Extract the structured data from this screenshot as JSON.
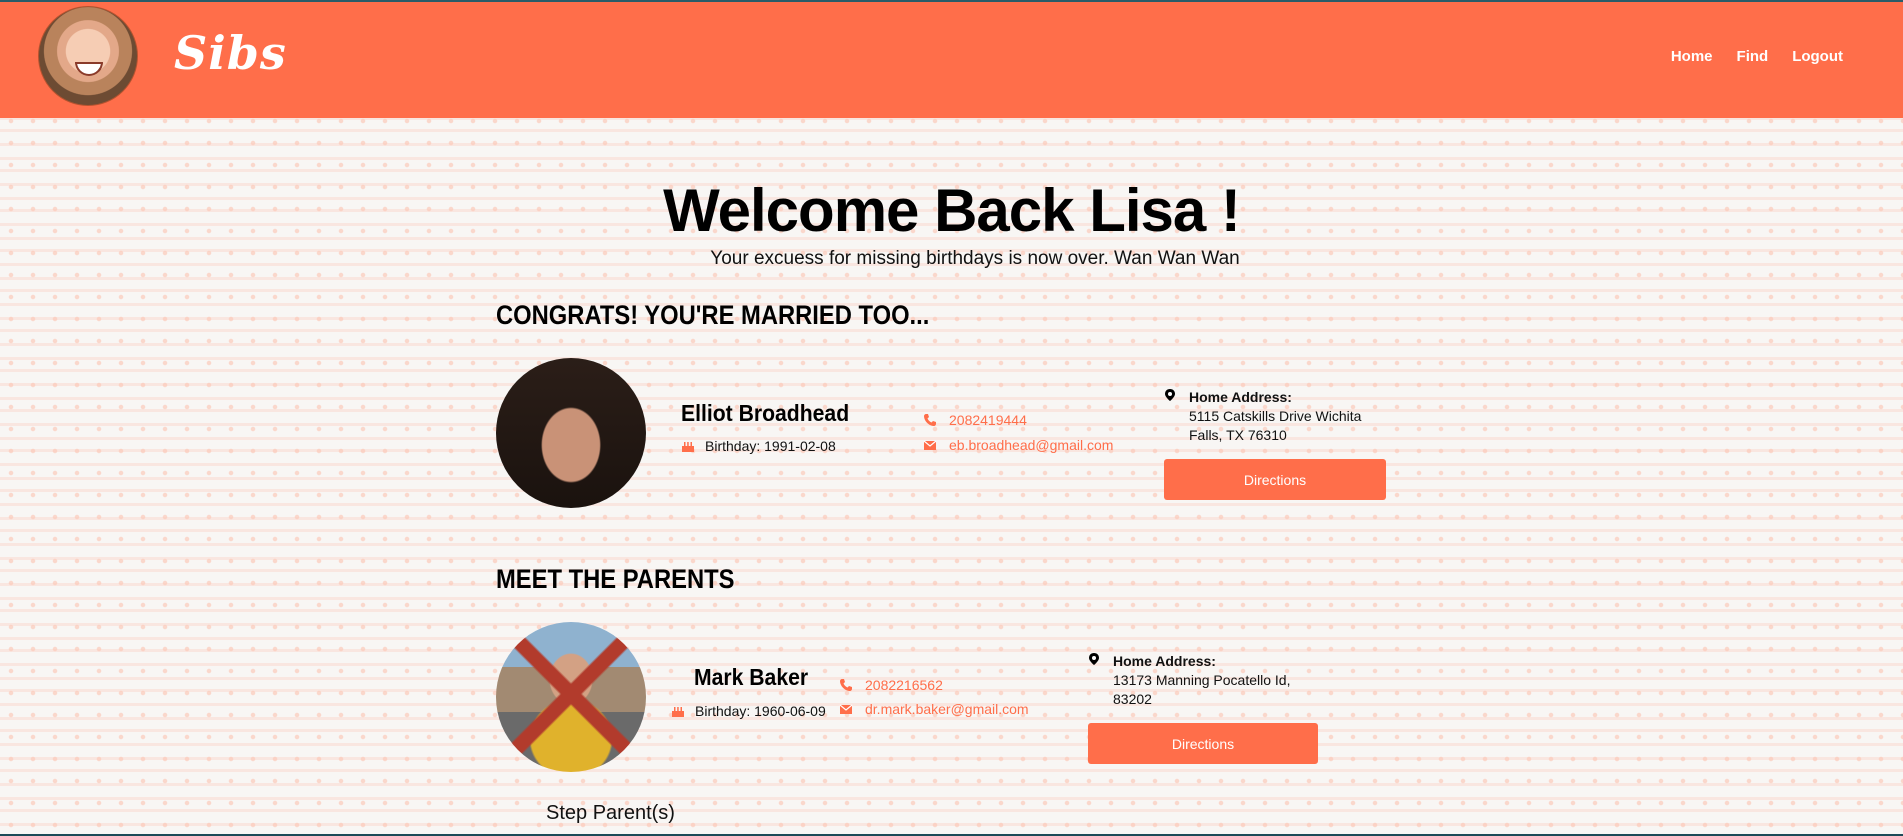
{
  "brand": "Sibs",
  "nav": {
    "home": "Home",
    "find": "Find",
    "logout": "Logout"
  },
  "welcome": "Welcome Back Lisa !",
  "subtitle": "Your excuess for missing birthdays is now over. Wan Wan Wan",
  "spouse_section": {
    "heading": "CONGRATS! YOU'RE MARRIED TOO...",
    "person": {
      "name": "Elliot Broadhead",
      "birthday": "Birthday: 1991-02-08",
      "phone": "2082419444",
      "email": "eb.broadhead@gmail.com",
      "address_label": "Home Address:",
      "address_line1": "5115 Catskills Drive Wichita",
      "address_line2": "Falls, TX 76310",
      "directions": "Directions"
    }
  },
  "parents_section": {
    "heading": "MEET THE PARENTS",
    "person": {
      "name": "Mark Baker",
      "birthday": "Birthday: 1960-06-09",
      "phone": "2082216562",
      "email": "dr.mark.baker@gmail.com",
      "address_label": "Home Address:",
      "address_line1": "13173 Manning Pocatello Id,",
      "address_line2": "83202",
      "directions": "Directions"
    },
    "step_parents_label": "Step Parent(s)"
  },
  "colors": {
    "accent": "#ff6e4a",
    "nav_background": "#ff6e4a",
    "text": "#000000"
  },
  "icons": [
    "birthday-cake-icon",
    "phone-icon",
    "envelope-icon",
    "map-marker-icon"
  ]
}
